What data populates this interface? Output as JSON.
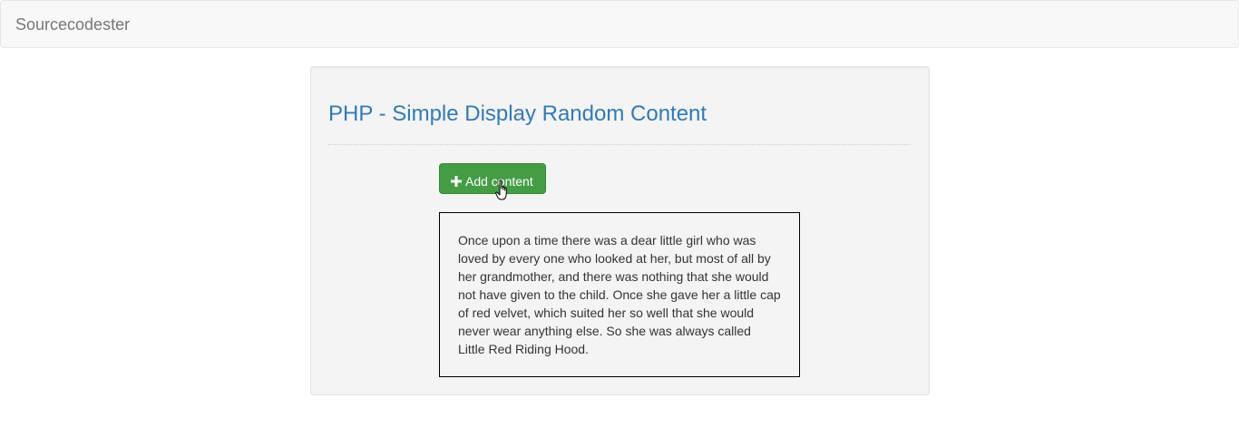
{
  "navbar": {
    "brand": "Sourcecodester"
  },
  "panel": {
    "title": "PHP - Simple Display Random Content",
    "add_button": {
      "label": "Add content",
      "icon": "plus-icon",
      "color": "#449d44"
    },
    "content_text": "Once upon a time there was a dear little girl who was loved by every one who looked at her, but most of all by her grandmother, and there was nothing that she would not have given to the child. Once she gave her a little cap of red velvet, which suited her so well that she would never wear anything else. So she was always called Little Red Riding Hood."
  },
  "colors": {
    "title": "#337ab7",
    "navbar_bg": "#f8f8f8",
    "panel_bg": "#f4f4f4"
  },
  "cursor": {
    "icon": "hand-pointer-icon"
  }
}
